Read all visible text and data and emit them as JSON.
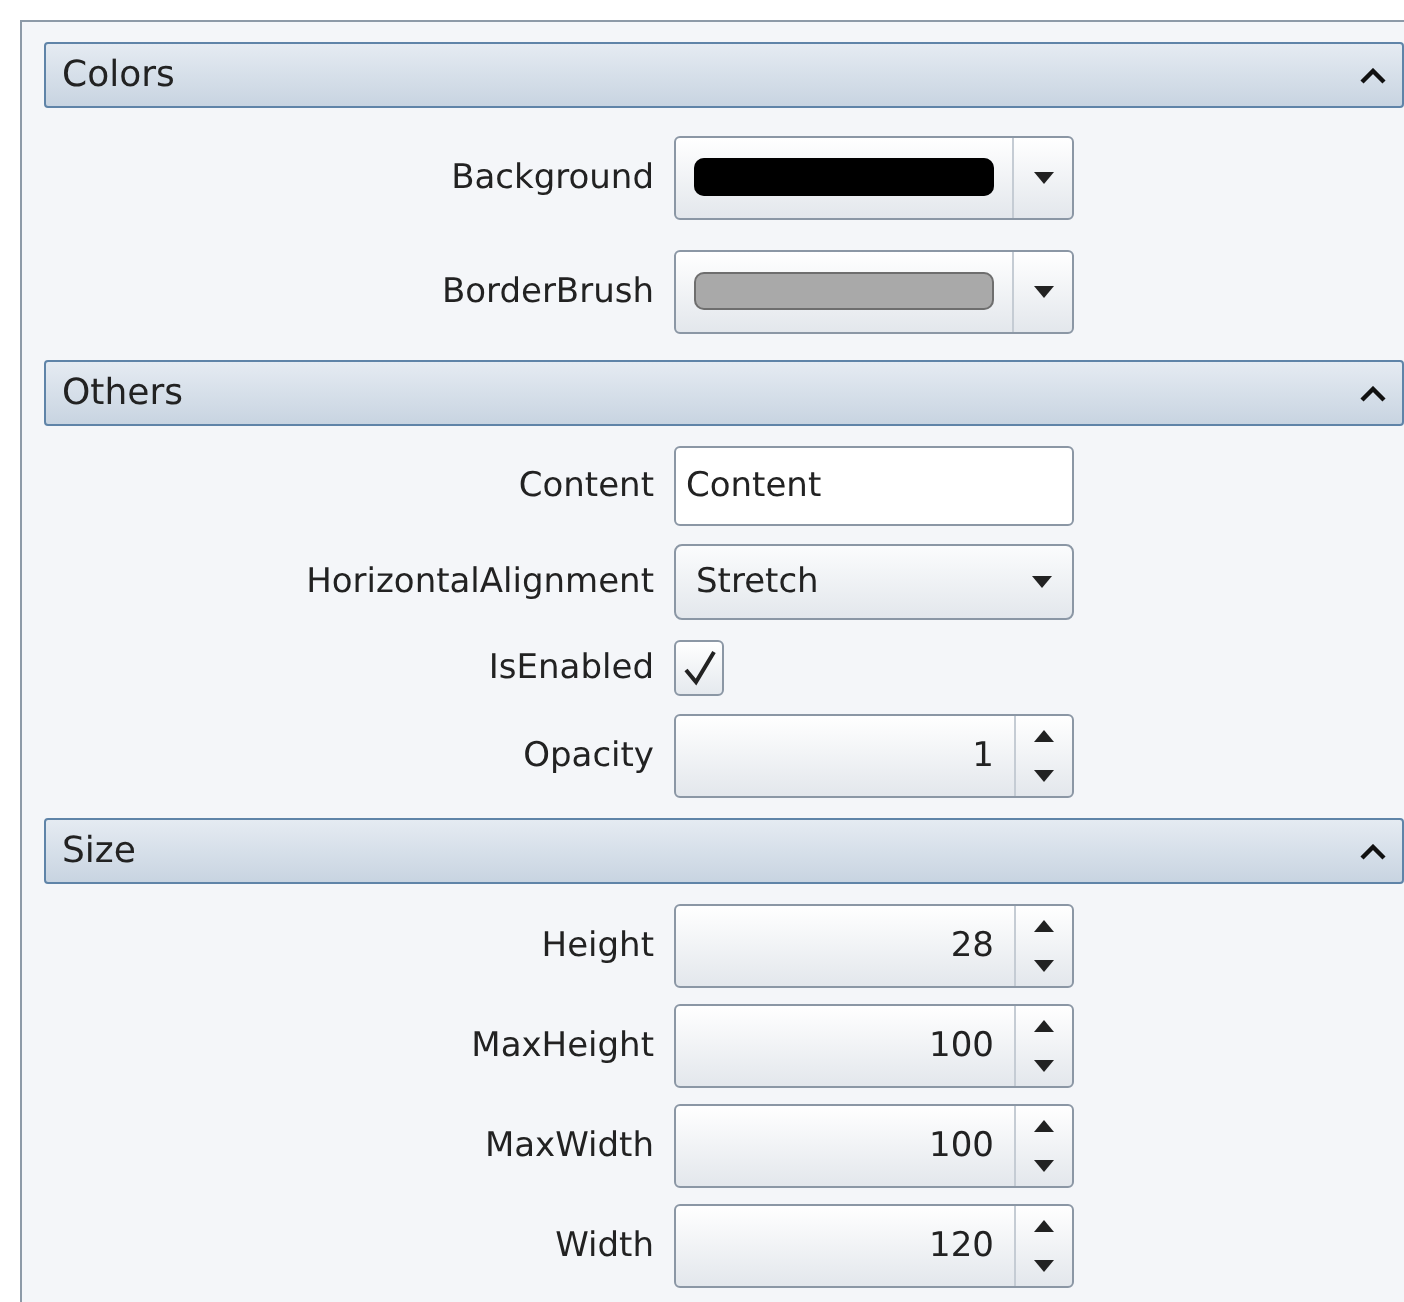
{
  "categories": [
    {
      "title": "Colors",
      "expanded": true,
      "properties": [
        {
          "kind": "color",
          "label": "Background",
          "color": "#000000"
        },
        {
          "kind": "color",
          "label": "BorderBrush",
          "color": "#a9a9a9"
        }
      ]
    },
    {
      "title": "Others",
      "expanded": true,
      "properties": [
        {
          "kind": "text",
          "label": "Content",
          "value": "Content"
        },
        {
          "kind": "combo",
          "label": "HorizontalAlignment",
          "value": "Stretch"
        },
        {
          "kind": "check",
          "label": "IsEnabled",
          "checked": true
        },
        {
          "kind": "number",
          "label": "Opacity",
          "value": "1"
        }
      ]
    },
    {
      "title": "Size",
      "expanded": true,
      "properties": [
        {
          "kind": "number",
          "label": "Height",
          "value": "28"
        },
        {
          "kind": "number",
          "label": "MaxHeight",
          "value": "100"
        },
        {
          "kind": "number",
          "label": "MaxWidth",
          "value": "100"
        },
        {
          "kind": "number",
          "label": "Width",
          "value": "120"
        }
      ]
    }
  ]
}
